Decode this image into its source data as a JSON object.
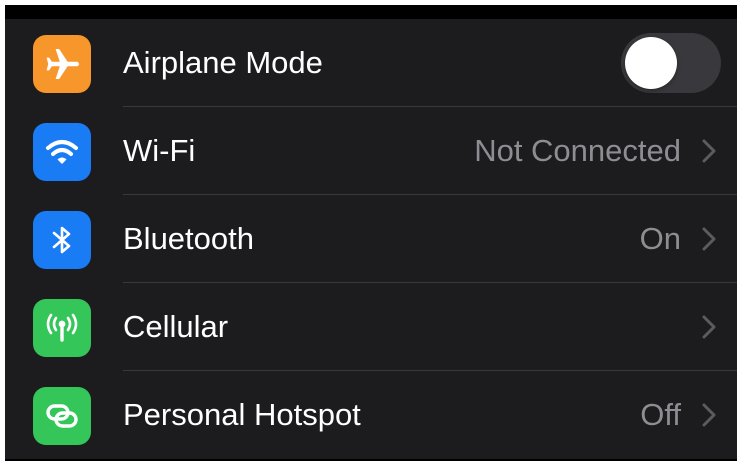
{
  "settings": {
    "rows": [
      {
        "label": "Airplane Mode",
        "icon": "airplane-icon",
        "icon_color": "#f7962a",
        "control": "toggle",
        "toggle_on": false
      },
      {
        "label": "Wi-Fi",
        "value": "Not Connected",
        "icon": "wifi-icon",
        "icon_color": "#1a7cf5",
        "control": "disclosure"
      },
      {
        "label": "Bluetooth",
        "value": "On",
        "icon": "bluetooth-icon",
        "icon_color": "#1a7cf5",
        "control": "disclosure"
      },
      {
        "label": "Cellular",
        "value": "",
        "icon": "cellular-antenna-icon",
        "icon_color": "#35c65a",
        "control": "disclosure"
      },
      {
        "label": "Personal Hotspot",
        "value": "Off",
        "icon": "hotspot-link-icon",
        "icon_color": "#35c65a",
        "control": "disclosure"
      }
    ]
  },
  "theme": {
    "background": "#000000",
    "group_background": "#1c1c1e",
    "label_color": "#ffffff",
    "value_color": "#8d8d93",
    "separator_color": "#38383a",
    "toggle_off_color": "#39393d"
  }
}
